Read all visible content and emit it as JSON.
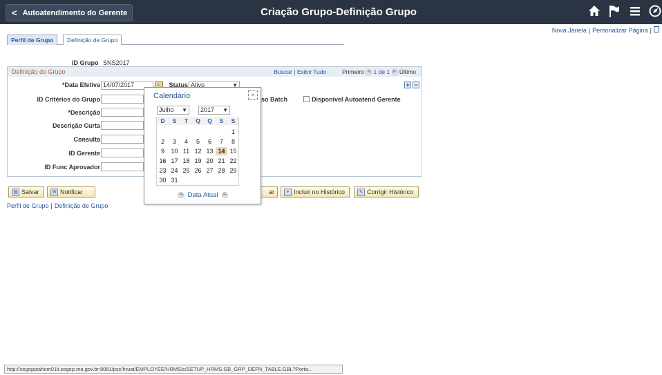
{
  "header": {
    "back_label": "Autoatendimento do Gerente",
    "title": "Criação Grupo-Definição Grupo",
    "icons": [
      "home-icon",
      "flag-icon",
      "menu-icon",
      "navbar-icon"
    ]
  },
  "utils": {
    "new_window": "Nova Janela",
    "personalize": "Personalizar Página"
  },
  "tabs": [
    {
      "label": "Perfil de Grupo"
    },
    {
      "label": "Definição de Grupo"
    }
  ],
  "id_grupo": {
    "label": "ID Grupo",
    "value": "SNS2017"
  },
  "section": {
    "title": "Definição do Grupo",
    "buscar": "Buscar",
    "exibir": "Exibir Tudo",
    "primeiro": "Primeiro",
    "pagina": "1 de 1",
    "ultimo": "Último",
    "add": "+",
    "remove": "−"
  },
  "fields": {
    "data_efetiva_label": "*Data Efetiva",
    "data_efetiva_value": "14/07/2017",
    "status_label": "Status",
    "status_value": "Ativo",
    "criterios_label": "ID Critérios do Grupo",
    "batch_label": "so Batch",
    "disponivel_label": "Disponível Autoatend Gerente",
    "descricao_label": "*Descrição",
    "desc_curta_label": "Descrição Curta",
    "consulta_label": "Consulta",
    "gerente_label": "ID Gerente",
    "func_aprovador_label": "ID Func Aprovador"
  },
  "buttons": {
    "salvar": "Salvar",
    "notificar": "Notificar",
    "partial": "ar",
    "incluir": "Incluir no Histórico",
    "corrigir": "Corrigir Histórico"
  },
  "bottom_links": [
    "Perfil de Grupo",
    "Definição de Grupo"
  ],
  "calendar": {
    "title": "Calendário",
    "close": "×",
    "month": "Julho",
    "year": "2017",
    "weekdays": [
      "D",
      "S",
      "T",
      "Q",
      "Q",
      "S",
      "S"
    ],
    "today": "14",
    "data_atual": "Data Atual",
    "weeks": [
      [
        "",
        "",
        "",
        "",
        "",
        "",
        "1"
      ],
      [
        "2",
        "3",
        "4",
        "5",
        "6",
        "7",
        "8"
      ],
      [
        "9",
        "10",
        "11",
        "12",
        "13",
        "14",
        "15"
      ],
      [
        "16",
        "17",
        "18",
        "19",
        "20",
        "21",
        "22"
      ],
      [
        "23",
        "24",
        "25",
        "26",
        "27",
        "28",
        "29"
      ],
      [
        "30",
        "31",
        "",
        "",
        "",
        "",
        ""
      ]
    ]
  },
  "status_url": "http://segeppiahom01li.segep.ma.gov.br:8081/psc/hruat/EMPLOYEE/HRMS/c/SETUP_HRMS.GB_GRP_DEFN_TABLE.GBL?Porta..."
}
